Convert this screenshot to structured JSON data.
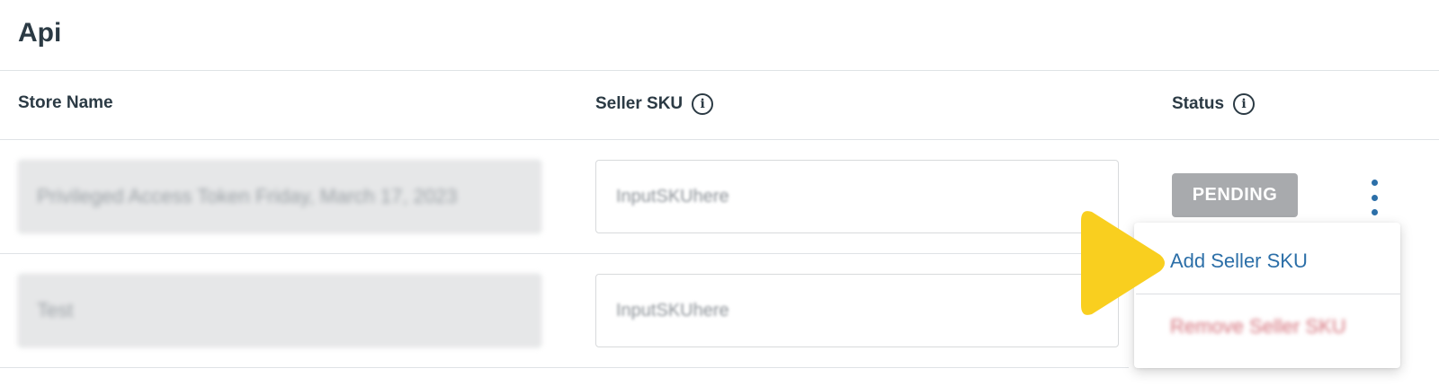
{
  "section": {
    "title": "Api"
  },
  "table": {
    "columns": {
      "store_name": "Store Name",
      "seller_sku": "Seller SKU",
      "status": "Status"
    },
    "rows": [
      {
        "store_name": "Privileged Access Token Friday, March 17, 2023",
        "seller_sku_placeholder": "InputSKUhere",
        "status": "PENDING"
      },
      {
        "store_name": "Test",
        "seller_sku_placeholder": "InputSKUhere",
        "status": ""
      }
    ]
  },
  "row_menu": {
    "add_label": "Add Seller SKU",
    "remove_label": "Remove Seller SKU"
  },
  "icons": {
    "info": "info-icon",
    "kebab": "kebab-menu-icon",
    "pointer": "pointer-arrow-icon"
  },
  "colors": {
    "accent_blue": "#2c6fa8",
    "danger": "#d4707a",
    "badge_gray": "#a8aaad",
    "pointer_yellow": "#f9cf1f"
  }
}
